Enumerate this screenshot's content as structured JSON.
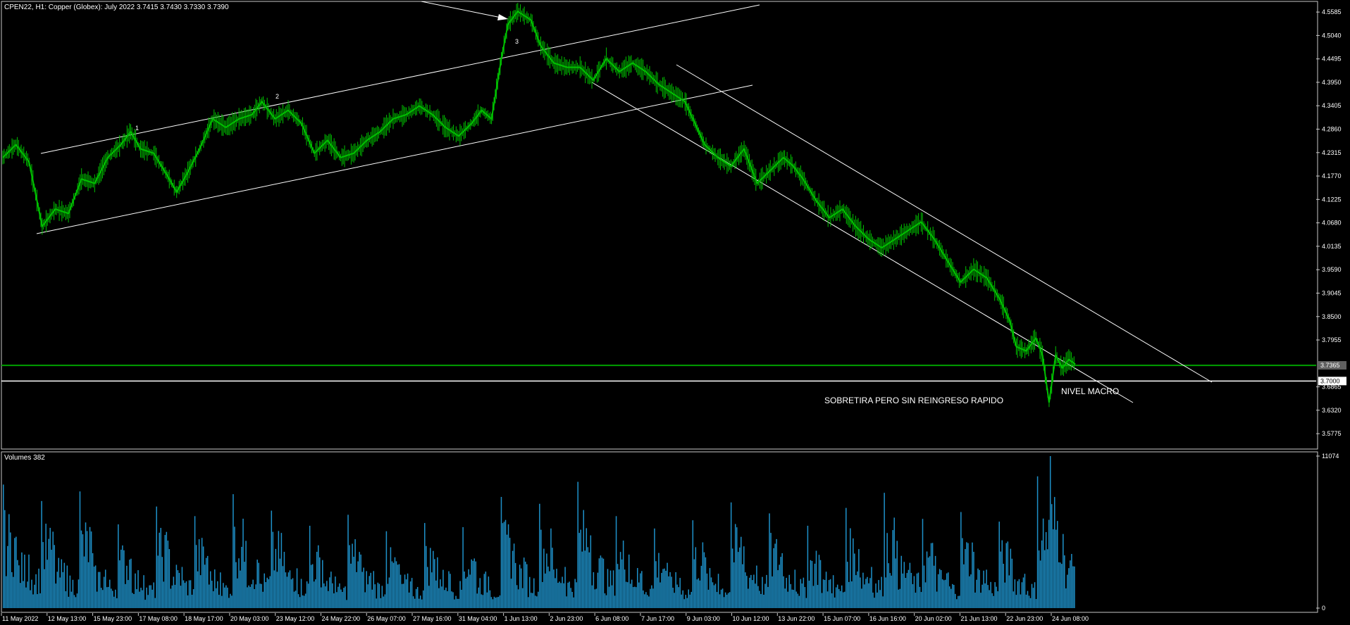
{
  "header": {
    "symbol_info": "CPEN22, H1:  Copper (Globex): July 2022  3.7415 3.7430 3.7330 3.7390",
    "volume_label": "Volumes 382"
  },
  "colors": {
    "background": "#000000",
    "candle": "#00c000",
    "volume": "#1e90c8",
    "trendline": "#ffffff",
    "current_price_line": "#00a000",
    "macro_line": "#ffffff"
  },
  "chart_data": [
    {
      "type": "line",
      "title": "",
      "price_axis_ticks": [
        "4.5585",
        "4.5040",
        "4.4495",
        "4.3950",
        "4.3405",
        "4.2860",
        "4.2315",
        "4.1770",
        "4.1225",
        "4.0680",
        "4.0135",
        "3.9590",
        "3.9045",
        "3.8500",
        "3.7955",
        "3.6865",
        "3.6320",
        "3.5775"
      ],
      "ylim": [
        3.545,
        4.58
      ],
      "x_labels": [
        "11 May 2022",
        "12 May 13:00",
        "15 May 23:00",
        "17 May 08:00",
        "18 May 17:00",
        "20 May 03:00",
        "23 May 12:00",
        "24 May 22:00",
        "26 May 07:00",
        "27 May 16:00",
        "31 May 04:00",
        "1 Jun 13:00",
        "2 Jun 23:00",
        "6 Jun 08:00",
        "7 Jun 17:00",
        "9 Jun 03:00",
        "10 Jun 12:00",
        "13 Jun 22:00",
        "15 Jun 07:00",
        "16 Jun 16:00",
        "20 Jun 02:00",
        "21 Jun 13:00",
        "22 Jun 23:00",
        "24 Jun 08:00"
      ],
      "price_path": [
        {
          "x": 0,
          "y": 4.22
        },
        {
          "x": 4,
          "y": 4.25
        },
        {
          "x": 8,
          "y": 4.21
        },
        {
          "x": 12,
          "y": 4.06
        },
        {
          "x": 16,
          "y": 4.1
        },
        {
          "x": 20,
          "y": 4.09
        },
        {
          "x": 24,
          "y": 4.17
        },
        {
          "x": 28,
          "y": 4.16
        },
        {
          "x": 32,
          "y": 4.22
        },
        {
          "x": 36,
          "y": 4.25
        },
        {
          "x": 39,
          "y": 4.28
        },
        {
          "x": 42,
          "y": 4.24
        },
        {
          "x": 46,
          "y": 4.23
        },
        {
          "x": 50,
          "y": 4.18
        },
        {
          "x": 53,
          "y": 4.14
        },
        {
          "x": 56,
          "y": 4.18
        },
        {
          "x": 60,
          "y": 4.24
        },
        {
          "x": 64,
          "y": 4.31
        },
        {
          "x": 68,
          "y": 4.29
        },
        {
          "x": 72,
          "y": 4.31
        },
        {
          "x": 76,
          "y": 4.32
        },
        {
          "x": 79,
          "y": 4.35
        },
        {
          "x": 83,
          "y": 4.31
        },
        {
          "x": 87,
          "y": 4.33
        },
        {
          "x": 91,
          "y": 4.3
        },
        {
          "x": 95,
          "y": 4.23
        },
        {
          "x": 99,
          "y": 4.26
        },
        {
          "x": 103,
          "y": 4.22
        },
        {
          "x": 107,
          "y": 4.23
        },
        {
          "x": 111,
          "y": 4.26
        },
        {
          "x": 115,
          "y": 4.28
        },
        {
          "x": 119,
          "y": 4.31
        },
        {
          "x": 123,
          "y": 4.32
        },
        {
          "x": 127,
          "y": 4.34
        },
        {
          "x": 131,
          "y": 4.32
        },
        {
          "x": 135,
          "y": 4.29
        },
        {
          "x": 139,
          "y": 4.27
        },
        {
          "x": 143,
          "y": 4.3
        },
        {
          "x": 146,
          "y": 4.33
        },
        {
          "x": 149,
          "y": 4.31
        },
        {
          "x": 152,
          "y": 4.45
        },
        {
          "x": 154,
          "y": 4.53
        },
        {
          "x": 157,
          "y": 4.56
        },
        {
          "x": 161,
          "y": 4.54
        },
        {
          "x": 164,
          "y": 4.48
        },
        {
          "x": 168,
          "y": 4.44
        },
        {
          "x": 172,
          "y": 4.43
        },
        {
          "x": 176,
          "y": 4.43
        },
        {
          "x": 180,
          "y": 4.4
        },
        {
          "x": 184,
          "y": 4.45
        },
        {
          "x": 188,
          "y": 4.42
        },
        {
          "x": 192,
          "y": 4.44
        },
        {
          "x": 196,
          "y": 4.42
        },
        {
          "x": 200,
          "y": 4.39
        },
        {
          "x": 204,
          "y": 4.37
        },
        {
          "x": 208,
          "y": 4.35
        },
        {
          "x": 211,
          "y": 4.3
        },
        {
          "x": 214,
          "y": 4.25
        },
        {
          "x": 218,
          "y": 4.22
        },
        {
          "x": 222,
          "y": 4.2
        },
        {
          "x": 226,
          "y": 4.24
        },
        {
          "x": 230,
          "y": 4.16
        },
        {
          "x": 234,
          "y": 4.19
        },
        {
          "x": 238,
          "y": 4.22
        },
        {
          "x": 241,
          "y": 4.2
        },
        {
          "x": 244,
          "y": 4.17
        },
        {
          "x": 248,
          "y": 4.12
        },
        {
          "x": 252,
          "y": 4.08
        },
        {
          "x": 256,
          "y": 4.1
        },
        {
          "x": 260,
          "y": 4.06
        },
        {
          "x": 264,
          "y": 4.03
        },
        {
          "x": 268,
          "y": 4.01
        },
        {
          "x": 272,
          "y": 4.03
        },
        {
          "x": 276,
          "y": 4.05
        },
        {
          "x": 280,
          "y": 4.07
        },
        {
          "x": 284,
          "y": 4.03
        },
        {
          "x": 288,
          "y": 3.98
        },
        {
          "x": 292,
          "y": 3.93
        },
        {
          "x": 296,
          "y": 3.96
        },
        {
          "x": 300,
          "y": 3.94
        },
        {
          "x": 304,
          "y": 3.89
        },
        {
          "x": 307,
          "y": 3.84
        },
        {
          "x": 309,
          "y": 3.78
        },
        {
          "x": 312,
          "y": 3.77
        },
        {
          "x": 315,
          "y": 3.8
        },
        {
          "x": 317,
          "y": 3.76
        },
        {
          "x": 319,
          "y": 3.65
        },
        {
          "x": 321,
          "y": 3.76
        },
        {
          "x": 323,
          "y": 3.73
        },
        {
          "x": 325,
          "y": 3.75
        },
        {
          "x": 327,
          "y": 3.739
        }
      ],
      "x_max": 400,
      "current_price": 3.7365,
      "current_price_label": "3.7365",
      "macro_level": 3.7,
      "macro_level_label": "3.7000",
      "wave_labels": [
        "1",
        "2",
        "3"
      ],
      "annotations": [
        "SOBRETIRA PERO SIN REINGRESO RAPIDO",
        "NIVEL MACRO"
      ]
    },
    {
      "type": "bar",
      "title": "Volumes 382",
      "ylim": [
        0,
        11074
      ],
      "y_ticks": [
        "11074",
        "0"
      ],
      "values": [
        9000,
        5200,
        3900,
        7800,
        4600,
        3100,
        8500,
        4000,
        2800,
        6100,
        3600,
        2400,
        7400,
        4300,
        3000,
        6700,
        3800,
        2600,
        8300,
        4900,
        3300,
        7100,
        4100,
        2900,
        6000,
        3500,
        2300,
        6800,
        3900,
        2700,
        5600,
        3200,
        2200,
        6200,
        3700,
        2500,
        5900,
        3400,
        2300,
        8100,
        4700,
        3200,
        7600,
        4400,
        3000,
        9200,
        5300,
        3600,
        6700,
        3900,
        2700,
        5800,
        3300,
        2200,
        6400,
        3700,
        2500,
        7700,
        4500,
        3100,
        6900,
        4000,
        2800,
        6000,
        3500,
        2400,
        7300,
        4300,
        3000,
        8400,
        4900,
        3300,
        6500,
        3800,
        2600,
        7000,
        4100,
        2800,
        6300,
        3600,
        2500,
        9600,
        11074,
        5400
      ]
    }
  ]
}
